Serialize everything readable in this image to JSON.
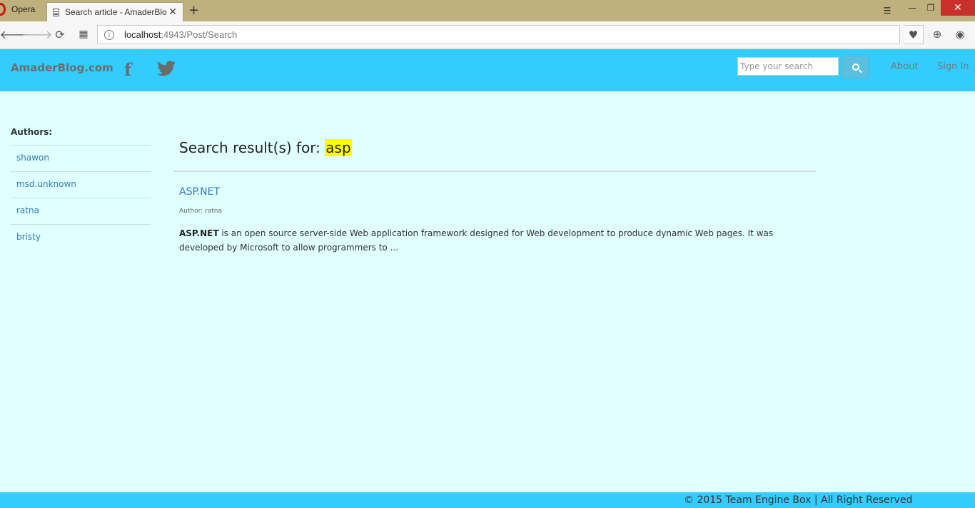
{
  "browser": {
    "app_name": "Opera",
    "tab_title": "Search article - AmaderBlo",
    "tab_close": "✕",
    "new_tab": "+",
    "url_host": "localhost",
    "url_rest": ":4943/Post/Search"
  },
  "site": {
    "brand": "AmaderBlog.com",
    "facebook_glyph": "f",
    "twitter_glyph": "🐦",
    "search_placeholder": "Type your search",
    "nav": {
      "about": "About",
      "sign_in": "Sign In"
    }
  },
  "sidebar": {
    "title": "Authors:",
    "authors": [
      "shawon",
      "msd.unknown",
      "ratna",
      "bristy"
    ]
  },
  "main": {
    "heading_prefix": "Search result(s) for: ",
    "query": "asp",
    "results": [
      {
        "title": "ASP.NET",
        "author": "Author: ratna",
        "excerpt_bold": "ASP.NET",
        "excerpt_rest": " is an open source server-side Web application framework designed for Web development to produce dynamic Web pages. It was developed by Microsoft to allow programmers to ..."
      }
    ]
  },
  "footer": {
    "text": "© 2015 Team Engine Box | All Right Reserved"
  },
  "colors": {
    "navbar": "#33ccff",
    "page_bg": "#e0ffff",
    "link": "#337ab7",
    "highlight": "#ffff00",
    "search_button": "#5bc0de"
  }
}
